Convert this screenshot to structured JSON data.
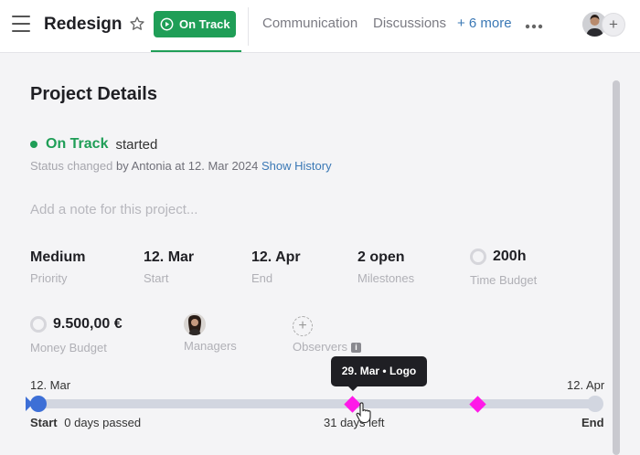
{
  "header": {
    "title": "Redesign",
    "status_label": "On Track",
    "tabs": [
      "Communication",
      "Discussions"
    ],
    "more_label": "+ 6 more"
  },
  "details": {
    "section_title": "Project Details",
    "status": "On Track",
    "status_suffix": "started",
    "status_changed_prefix": "Status changed",
    "status_changed_by": "by Antonia at 12. Mar 2024",
    "show_history": "Show History",
    "note_placeholder": "Add a note for this project...",
    "fields": {
      "priority": {
        "value": "Medium",
        "label": "Priority"
      },
      "start": {
        "value": "12. Mar",
        "label": "Start"
      },
      "end": {
        "value": "12. Apr",
        "label": "End"
      },
      "milestones": {
        "value": "2 open",
        "label": "Milestones"
      },
      "time_budget": {
        "value": "200h",
        "label": "Time Budget"
      },
      "money_budget": {
        "value": "9.500,00 €",
        "label": "Money Budget"
      },
      "managers": {
        "label": "Managers"
      },
      "observers": {
        "label": "Observers"
      }
    }
  },
  "timeline": {
    "start_date": "12. Mar",
    "end_date": "12. Apr",
    "start_label": "Start",
    "days_passed": "0 days passed",
    "days_left": "31 days left",
    "end_label": "End",
    "tooltip": "29. Mar • Logo",
    "milestone_positions": [
      0.565,
      0.79
    ],
    "colors": {
      "progress": "#3d6fd6",
      "milestone": "#ff19e8",
      "track": "#d2d6e0"
    }
  },
  "colors": {
    "accent_green": "#1f9e57",
    "link_blue": "#3a78b5"
  }
}
